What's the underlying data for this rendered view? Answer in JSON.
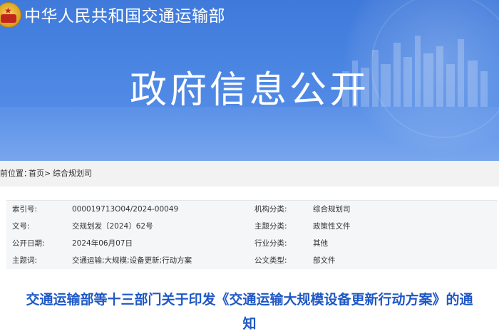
{
  "header": {
    "ministry_name": "中华人民共和国交通运输部",
    "section_title": "政府信息公开"
  },
  "breadcrumb": {
    "label": "前位置：",
    "home": "首页",
    "separator": ">",
    "current": "综合规划司"
  },
  "info_table": {
    "rows": [
      {
        "label1": "索引号:",
        "value1": "000019713O04/2024-00049",
        "label2": "机构分类:",
        "value2": "综合规划司"
      },
      {
        "label1": "文号:",
        "value1": "交规划发〔2024〕62号",
        "label2": "主题分类:",
        "value2": "政策性文件"
      },
      {
        "label1": "公开日期:",
        "value1": "2024年06月07日",
        "label2": "行业分类:",
        "value2": "其他"
      },
      {
        "label1": "主题词:",
        "value1": "交通运输;大规模;设备更新;行动方案",
        "label2": "公文类型:",
        "value2": "部文件"
      }
    ]
  },
  "document": {
    "title_line1": "交通运输部等十三部门关于印发《交通运输大规模设备更新行动方案》的通",
    "title_line2": "知"
  },
  "colors": {
    "banner_blue": "#4c86e3",
    "title_blue": "#1f58c6",
    "breadcrumb_bg": "#f2f2f2",
    "table_bg": "#f5f6f8"
  },
  "icons": {
    "emblem": "national-emblem-icon"
  }
}
